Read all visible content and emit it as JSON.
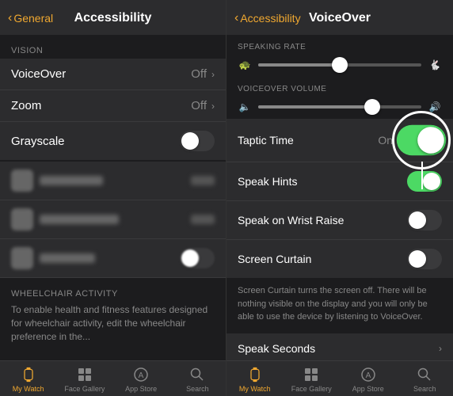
{
  "left": {
    "nav": {
      "back_label": "General",
      "title": "Accessibility"
    },
    "section_vision": "VISION",
    "items": [
      {
        "label": "VoiceOver",
        "value": "Off",
        "type": "nav"
      },
      {
        "label": "Zoom",
        "value": "Off",
        "type": "nav"
      },
      {
        "label": "Grayscale",
        "value": "",
        "type": "toggle",
        "state": "off"
      }
    ],
    "wheelchair_section": "WHEELCHAIR ACTIVITY",
    "wheelchair_desc": "To enable health and fitness features designed for wheelchair activity, edit the wheelchair preference in the...",
    "tabs": [
      {
        "label": "My Watch",
        "icon": "watch",
        "active": true
      },
      {
        "label": "Face Gallery",
        "icon": "grid",
        "active": false
      },
      {
        "label": "App Store",
        "icon": "store",
        "active": false
      },
      {
        "label": "Search",
        "icon": "search",
        "active": false
      }
    ]
  },
  "right": {
    "nav": {
      "back_label": "Accessibility",
      "title": "VoiceOver"
    },
    "speaking_rate_label": "SPEAKING RATE",
    "speaking_rate_value": 0.5,
    "voiceover_volume_label": "VOICEOVER VOLUME",
    "voiceover_volume_value": 0.7,
    "items": [
      {
        "label": "Taptic Time",
        "value": "On",
        "type": "nav_toggle",
        "state": "on"
      },
      {
        "label": "Speak Hints",
        "value": "",
        "type": "toggle",
        "state": "on"
      },
      {
        "label": "Speak on Wrist Raise",
        "value": "",
        "type": "toggle",
        "state": "off"
      },
      {
        "label": "Screen Curtain",
        "value": "",
        "type": "toggle",
        "state": "off"
      }
    ],
    "screen_curtain_desc": "Screen Curtain turns the screen off. There will be nothing visible on the display and you will only be able to use the device by listening to VoiceOver.",
    "speak_seconds_label": "Speak Seconds",
    "tabs": [
      {
        "label": "My Watch",
        "icon": "watch",
        "active": true
      },
      {
        "label": "Face Gallery",
        "icon": "grid",
        "active": false
      },
      {
        "label": "App Store",
        "icon": "store",
        "active": false
      },
      {
        "label": "Search",
        "icon": "search",
        "active": false
      }
    ]
  }
}
